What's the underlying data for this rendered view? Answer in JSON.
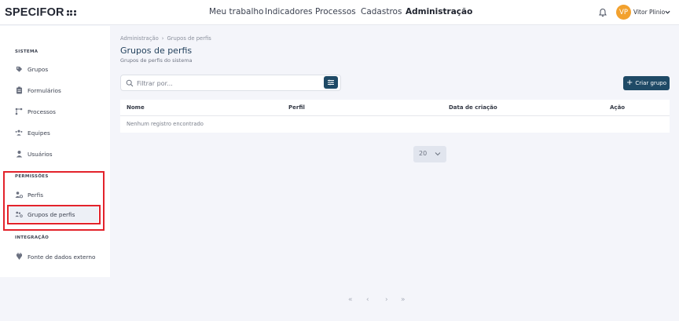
{
  "app": {
    "logo_text": "SPECIFOR"
  },
  "nav": {
    "items": [
      "Meu trabalho",
      "Indicadores",
      "Processos",
      "Cadastros",
      "Administração"
    ],
    "active": "Administração"
  },
  "user": {
    "initials": "VP",
    "name": "Vitor Plinio"
  },
  "sidebar": {
    "sections": [
      {
        "title": "SISTEMA",
        "items": [
          {
            "label": "Grupos",
            "icon": "tag-icon"
          },
          {
            "label": "Formulários",
            "icon": "clipboard-icon"
          },
          {
            "label": "Processos",
            "icon": "process-icon"
          },
          {
            "label": "Equipes",
            "icon": "team-icon"
          },
          {
            "label": "Usuários",
            "icon": "user-icon"
          }
        ]
      },
      {
        "title": "PERMISSÕES",
        "items": [
          {
            "label": "Perfis",
            "icon": "profile-icon"
          },
          {
            "label": "Grupos de perfis",
            "icon": "profile-group-icon",
            "selected": true
          }
        ]
      },
      {
        "title": "INTEGRAÇÃO",
        "items": [
          {
            "label": "Fonte de dados externo",
            "icon": "data-source-icon"
          }
        ]
      }
    ]
  },
  "main": {
    "breadcrumb": [
      "Administração",
      "Grupos de perfis"
    ],
    "title": "Grupos de perfis",
    "subtitle": "Grupos de perfis do sistema",
    "search": {
      "placeholder": "Filtrar por...",
      "value": ""
    },
    "create_label": "Criar grupo",
    "table": {
      "columns": [
        "Nome",
        "Perfil",
        "Data de criação",
        "Ação"
      ],
      "empty_text": "Nenhum registro encontrado"
    },
    "pagination": {
      "first": "«",
      "prev": "‹",
      "next": "›",
      "last": "»",
      "page_size": "20"
    }
  },
  "colors": {
    "primary": "#1f4a66",
    "avatar": "#f2a12e",
    "highlight_box": "#e3232b"
  }
}
